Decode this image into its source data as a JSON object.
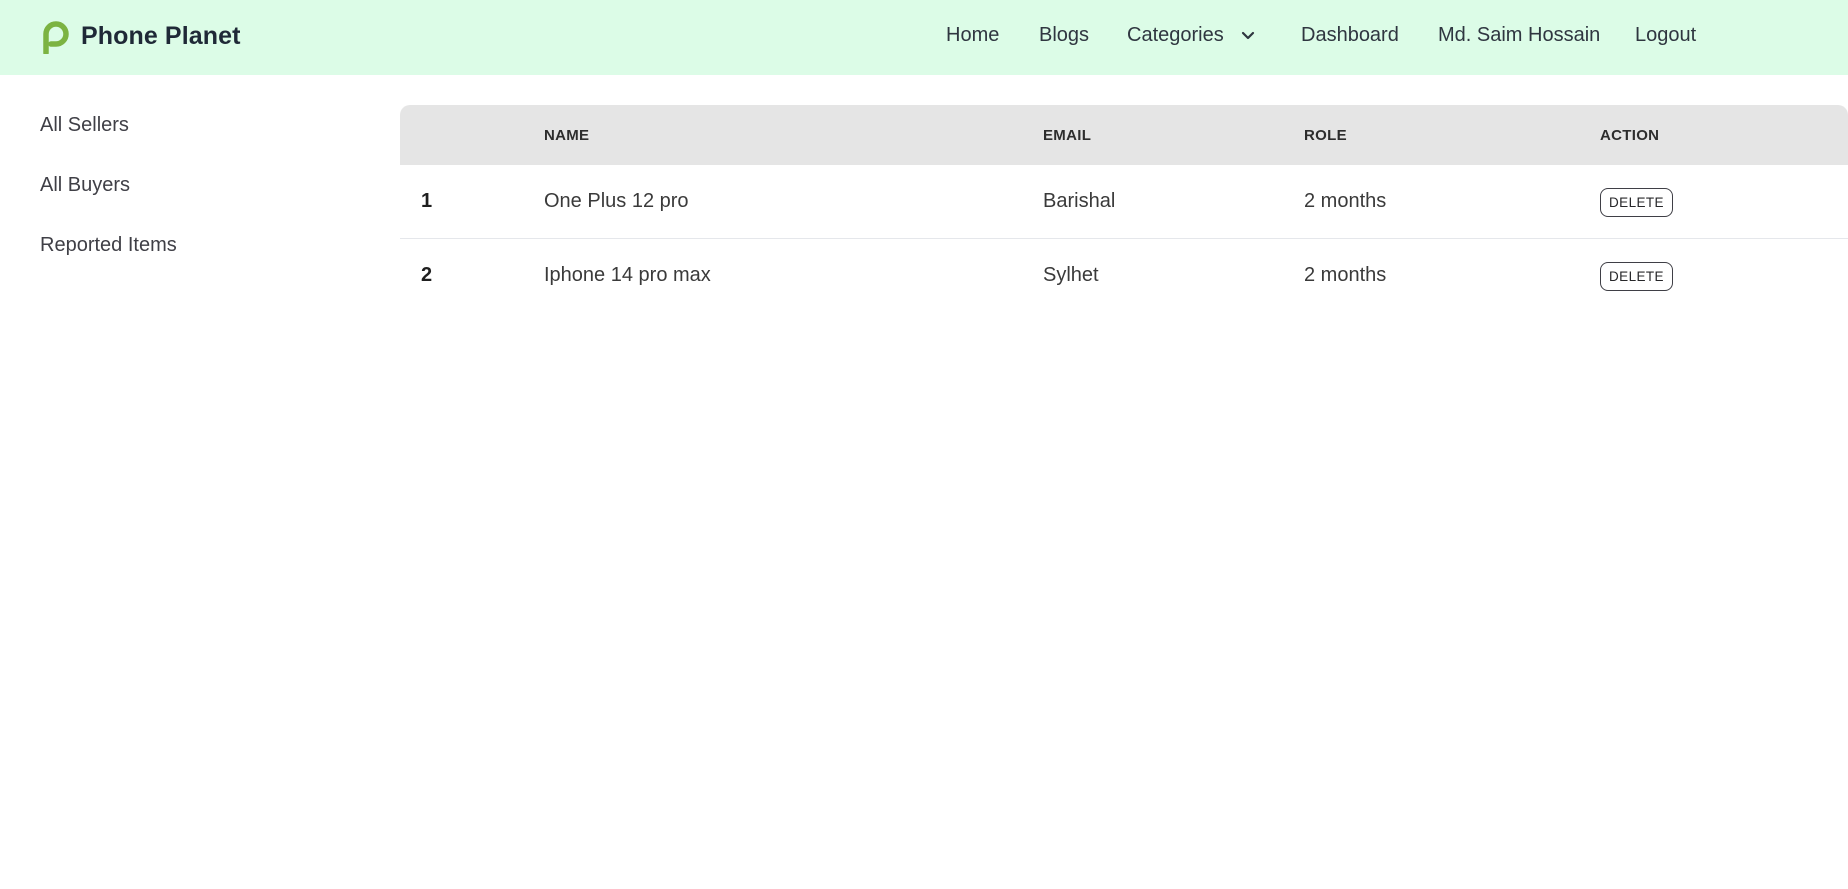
{
  "brand": {
    "name": "Phone Planet",
    "logo_icon": "p-letter-logo-icon",
    "logo_color": "#7cb342"
  },
  "navbar": {
    "background": "#dcfce7",
    "links": {
      "home": "Home",
      "blogs": "Blogs",
      "categories": "Categories",
      "dashboard": "Dashboard",
      "user": "Md. Saim Hossain",
      "logout": "Logout"
    }
  },
  "sidebar": {
    "items": [
      {
        "label": "All Sellers"
      },
      {
        "label": "All Buyers"
      },
      {
        "label": "Reported Items"
      }
    ]
  },
  "table": {
    "headers": {
      "index": "",
      "name": "NAME",
      "email": "EMAIL",
      "role": "ROLE",
      "action": "ACTION"
    },
    "rows": [
      {
        "index": "1",
        "name": "One Plus 12 pro",
        "email": "Barishal",
        "role": "2 months",
        "action": "DELETE"
      },
      {
        "index": "2",
        "name": "Iphone 14 pro max",
        "email": "Sylhet",
        "role": "2 months",
        "action": "DELETE"
      }
    ]
  }
}
